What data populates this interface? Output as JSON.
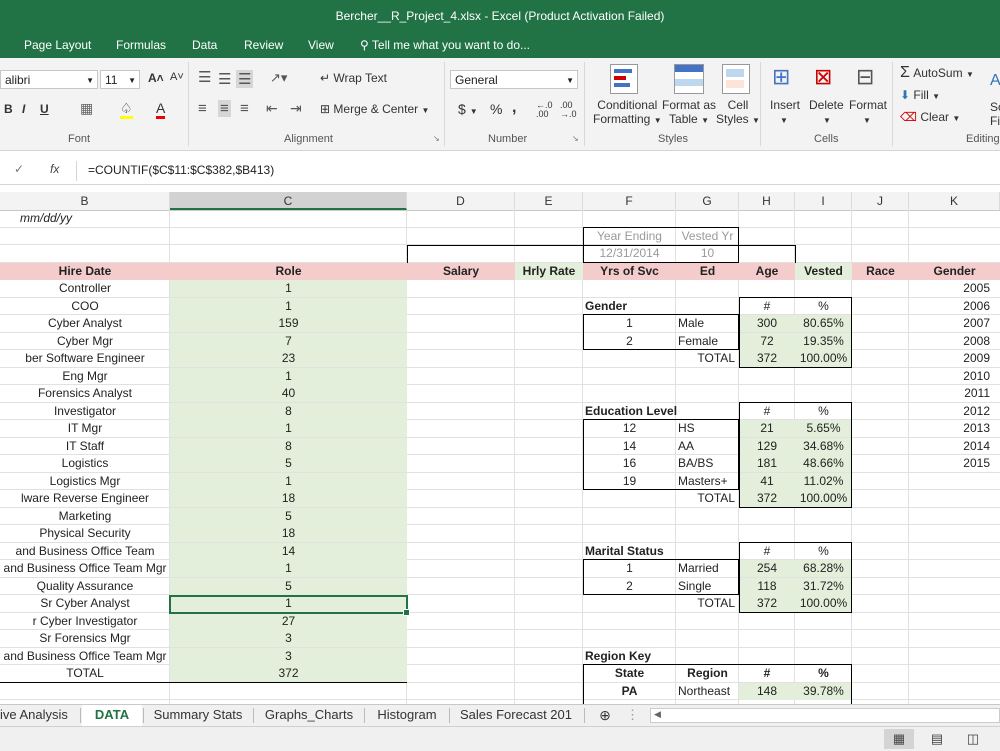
{
  "window": {
    "title": "Bercher__R_Project_4.xlsx - Excel (Product Activation Failed)"
  },
  "ribbon_tabs": [
    "Page Layout",
    "Formulas",
    "Data",
    "Review",
    "View"
  ],
  "tell_me": "Tell me what you want to do...",
  "ribbon": {
    "font_name": "alibri",
    "font_size": "11",
    "bold": "B",
    "italic": "I",
    "underline": "U",
    "wrap_text": "Wrap Text",
    "merge_center": "Merge & Center",
    "number_format": "General",
    "currency": "$",
    "percent": "%",
    "comma": ",",
    "cond_fmt_1": "Conditional",
    "cond_fmt_2": "Formatting",
    "fmt_table_1": "Format as",
    "fmt_table_2": "Table",
    "cell_styles_1": "Cell",
    "cell_styles_2": "Styles",
    "insert": "Insert",
    "delete": "Delete",
    "format": "Format",
    "autosum": "AutoSum",
    "fill": "Fill",
    "clear": "Clear",
    "sort_1": "So",
    "sort_2": "Fi",
    "groups": {
      "font": "Font",
      "alignment": "Alignment",
      "number": "Number",
      "styles": "Styles",
      "cells": "Cells",
      "editing": "Editing"
    }
  },
  "formula_bar": {
    "fx": "fx",
    "formula": "=COUNTIF($C$11:$C$382,$B413)"
  },
  "columns": [
    "B",
    "C",
    "D",
    "E",
    "F",
    "G",
    "H",
    "I",
    "J",
    "K"
  ],
  "row1": {
    "date_note": "mm/dd/yy"
  },
  "year_box": {
    "year_ending_label": "Year Ending",
    "vested_yr_label": "Vested Yr",
    "year_ending": "12/31/2014",
    "vested_yr": "10"
  },
  "headers": {
    "hire_date": "Hire Date",
    "role": "Role",
    "salary": "Salary",
    "hrly_rate": "Hrly Rate",
    "yrs_of_svc": "Yrs of Svc",
    "ed": "Ed",
    "age": "Age",
    "vested": "Vested",
    "race": "Race",
    "gender": "Gender"
  },
  "roles": [
    {
      "name": "Controller",
      "count": "1"
    },
    {
      "name": "COO",
      "count": "1"
    },
    {
      "name": "Cyber Analyst",
      "count": "159"
    },
    {
      "name": "Cyber Mgr",
      "count": "7"
    },
    {
      "name": "ber Software Engineer",
      "count": "23"
    },
    {
      "name": "Eng Mgr",
      "count": "1"
    },
    {
      "name": "Forensics Analyst",
      "count": "40"
    },
    {
      "name": "Investigator",
      "count": "8"
    },
    {
      "name": "IT Mgr",
      "count": "1"
    },
    {
      "name": "IT Staff",
      "count": "8"
    },
    {
      "name": "Logistics",
      "count": "5"
    },
    {
      "name": "Logistics Mgr",
      "count": "1"
    },
    {
      "name": "lware Reverse Engineer",
      "count": "18"
    },
    {
      "name": "Marketing",
      "count": "5"
    },
    {
      "name": "Physical Security",
      "count": "18"
    },
    {
      "name": "and Business Office Team",
      "count": "14"
    },
    {
      "name": "and Business Office Team Mgr",
      "count": "1"
    },
    {
      "name": "Quality Assurance",
      "count": "5"
    },
    {
      "name": "Sr Cyber Analyst",
      "count": "1"
    },
    {
      "name": "r Cyber Investigator",
      "count": "27"
    },
    {
      "name": "Sr Forensics Mgr",
      "count": "3"
    },
    {
      "name": "and Business Office Team Mgr",
      "count": "3"
    },
    {
      "name": "TOTAL",
      "count": "372"
    }
  ],
  "years": [
    "2005",
    "2006",
    "2007",
    "2008",
    "2009",
    "2010",
    "2011",
    "2012",
    "2013",
    "2014",
    "2015"
  ],
  "hash": "#",
  "pct": "%",
  "total_label": "TOTAL",
  "gender": {
    "title": "Gender",
    "rows": [
      {
        "code": "1",
        "label": "Male",
        "n": "300",
        "pct": "80.65%"
      },
      {
        "code": "2",
        "label": "Female",
        "n": "72",
        "pct": "19.35%"
      }
    ],
    "total_n": "372",
    "total_pct": "100.00%"
  },
  "education": {
    "title": "Education Level",
    "rows": [
      {
        "code": "12",
        "label": "HS",
        "n": "21",
        "pct": "5.65%"
      },
      {
        "code": "14",
        "label": "AA",
        "n": "129",
        "pct": "34.68%"
      },
      {
        "code": "16",
        "label": "BA/BS",
        "n": "181",
        "pct": "48.66%"
      },
      {
        "code": "19",
        "label": "Masters+",
        "n": "41",
        "pct": "11.02%"
      }
    ],
    "total_n": "372",
    "total_pct": "100.00%"
  },
  "marital": {
    "title": "Marital Status",
    "rows": [
      {
        "code": "1",
        "label": "Married",
        "n": "254",
        "pct": "68.28%"
      },
      {
        "code": "2",
        "label": "Single",
        "n": "118",
        "pct": "31.72%"
      }
    ],
    "total_n": "372",
    "total_pct": "100.00%"
  },
  "region": {
    "title": "Region Key",
    "state_label": "State",
    "region_label": "Region",
    "rows": [
      {
        "state": "PA",
        "region": "Northeast",
        "n": "148",
        "pct": "39.78%"
      }
    ]
  },
  "sheet_tabs": [
    "ive Analysis",
    "DATA",
    "Summary Stats",
    "Graphs_Charts",
    "Histogram",
    "Sales Forecast 201"
  ],
  "active_sheet": "DATA",
  "colors": {
    "excel_green": "#217346",
    "cell_green": "#e3efda",
    "header_pink": "#f4cccc"
  }
}
